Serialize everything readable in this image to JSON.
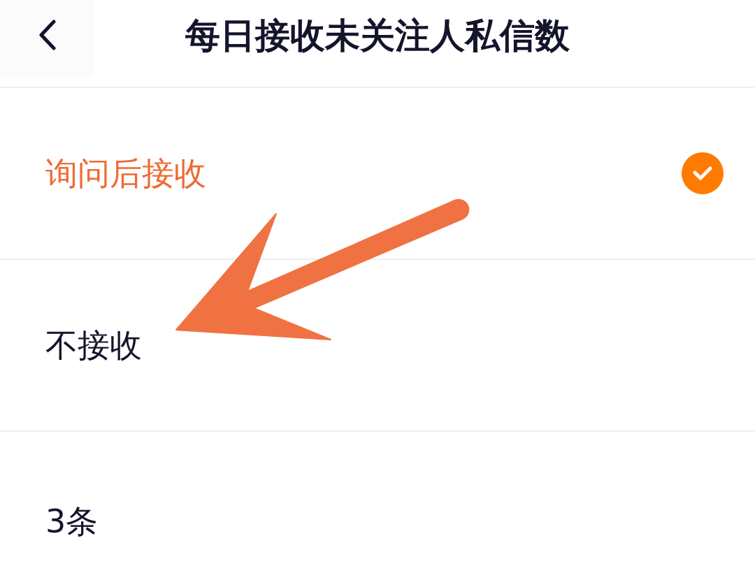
{
  "header": {
    "title": "每日接收未关注人私信数"
  },
  "options": [
    {
      "label": "询问后接收",
      "selected": true
    },
    {
      "label": "不接收",
      "selected": false
    },
    {
      "label": "3条",
      "selected": false
    }
  ]
}
